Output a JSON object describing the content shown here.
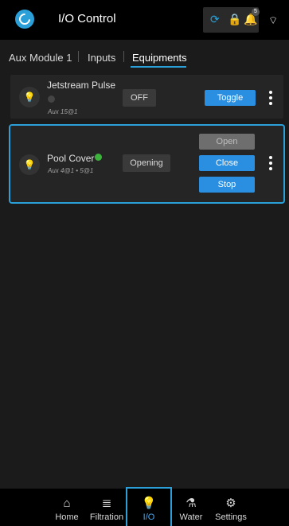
{
  "header": {
    "title": "I/O Control",
    "badge_count": "5"
  },
  "tabs": {
    "aux": "Aux Module 1",
    "inputs": "Inputs",
    "equipments": "Equipments"
  },
  "devices": [
    {
      "name": "Jetstream Pulse",
      "address": "Aux 15@1",
      "state": "OFF",
      "action": "Toggle",
      "status_color": "#444444"
    },
    {
      "name": "Pool Cover",
      "address": "Aux 4@1 • 5@1",
      "state": "Opening",
      "actions": [
        "Open",
        "Close",
        "Stop"
      ],
      "status_color": "#3cb43c"
    }
  ],
  "nav": [
    {
      "label": "Home",
      "icon": "home-icon"
    },
    {
      "label": "Filtration",
      "icon": "filtration-icon"
    },
    {
      "label": "I/O",
      "icon": "bulb-icon"
    },
    {
      "label": "Water",
      "icon": "flask-icon"
    },
    {
      "label": "Settings",
      "icon": "gear-icon"
    }
  ],
  "colors": {
    "accent": "#2a9fd8",
    "button": "#2a8fe0",
    "background": "#1b1b1b"
  }
}
